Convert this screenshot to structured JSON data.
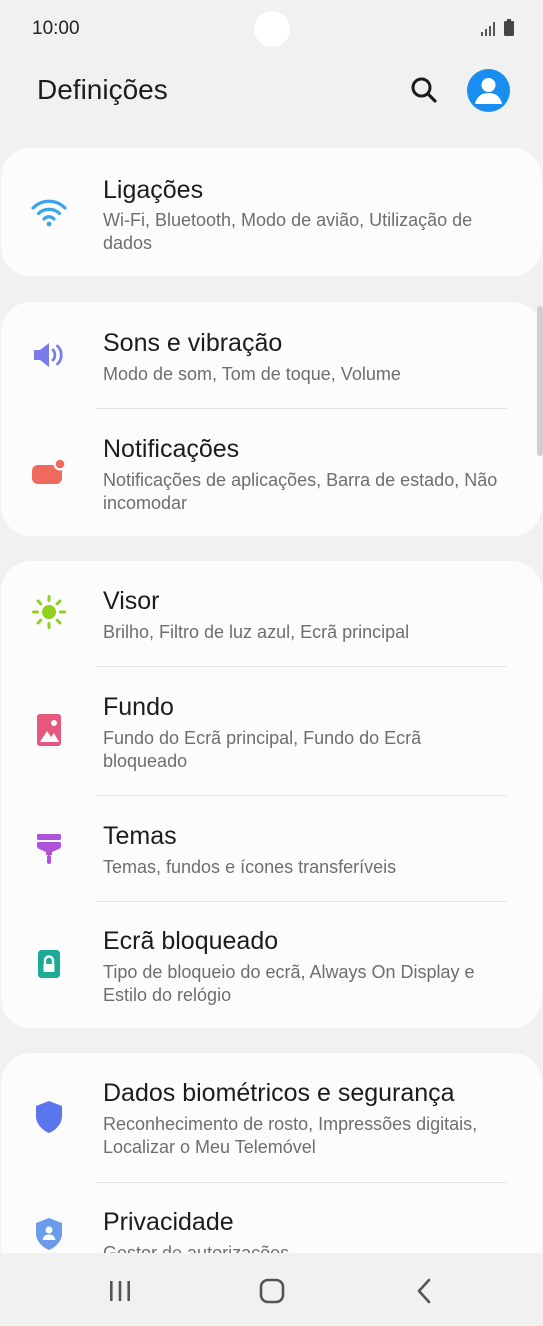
{
  "status_bar": {
    "time": "10:00"
  },
  "header": {
    "title": "Definições"
  },
  "settings": [
    {
      "label": "Ligações",
      "subtitle": "Wi-Fi, Bluetooth, Modo de avião, Utilização de dados",
      "icon": "wifi-icon",
      "color": "#3ba4ea"
    },
    {
      "label": "Sons e vibração",
      "subtitle": "Modo de som, Tom de toque, Volume",
      "icon": "speaker-icon",
      "color": "#7b7cec"
    },
    {
      "label": "Notificações",
      "subtitle": "Notificações de aplicações, Barra de estado, Não incomodar",
      "icon": "notification-icon",
      "color": "#ef6a5c"
    },
    {
      "label": "Visor",
      "subtitle": "Brilho, Filtro de luz azul, Ecrã principal",
      "icon": "sun-icon",
      "color": "#8fd11c"
    },
    {
      "label": "Fundo",
      "subtitle": "Fundo do Ecrã principal, Fundo do Ecrã bloqueado",
      "icon": "wallpaper-icon",
      "color": "#e5587e"
    },
    {
      "label": "Temas",
      "subtitle": "Temas, fundos e ícones transferíveis",
      "icon": "paint-brush-icon",
      "color": "#b153d9"
    },
    {
      "label": "Ecrã bloqueado",
      "subtitle": "Tipo de bloqueio do ecrã, Always On Display e Estilo do relógio",
      "icon": "lock-icon",
      "color": "#1bab96"
    },
    {
      "label": "Dados biométricos e segurança",
      "subtitle": "Reconhecimento de rosto, Impressões digitais, Localizar o Meu Telemóvel",
      "icon": "shield-icon",
      "color": "#5a76ec"
    },
    {
      "label": "Privacidade",
      "subtitle": "Gestor de autorizações",
      "icon": "privacy-shield-icon",
      "color": "#6b9bec"
    }
  ],
  "navigation": {
    "recents": "recents-icon",
    "home": "home-icon",
    "back": "back-icon"
  }
}
